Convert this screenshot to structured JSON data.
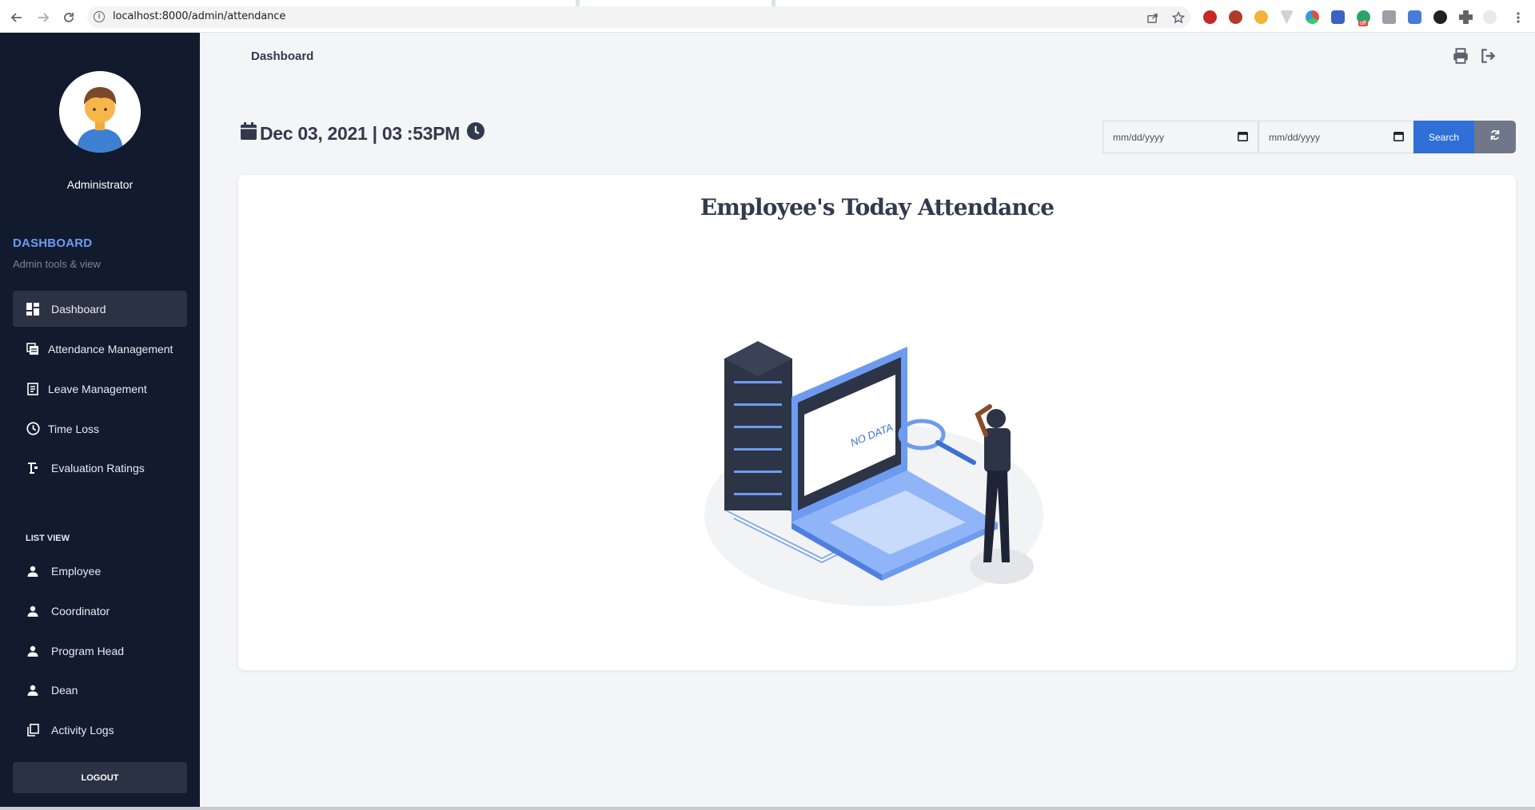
{
  "browser": {
    "url": "localhost:8000/admin/attendance",
    "info_icon": "info-icon",
    "ext_badge": "off"
  },
  "sidebar": {
    "user_name": "Administrator",
    "section_title": "DASHBOARD",
    "section_subtitle": "Admin tools & view",
    "items": [
      {
        "label": "Dashboard",
        "icon": "dashboard-icon"
      },
      {
        "label": "Attendance Management",
        "icon": "attendance-icon"
      },
      {
        "label": "Leave Management",
        "icon": "leave-icon"
      },
      {
        "label": "Time Loss",
        "icon": "clock-icon"
      },
      {
        "label": "Evaluation Ratings",
        "icon": "rating-icon"
      }
    ],
    "list_view_title": "LIST VIEW",
    "list_items": [
      {
        "label": "Employee",
        "icon": "person-icon"
      },
      {
        "label": "Coordinator",
        "icon": "person-icon"
      },
      {
        "label": "Program Head",
        "icon": "person-icon"
      },
      {
        "label": "Dean",
        "icon": "person-icon"
      },
      {
        "label": "Activity Logs",
        "icon": "copy-icon"
      }
    ],
    "logout_label": "LOGOUT"
  },
  "main": {
    "page_title": "Dashboard",
    "datetime": "Dec 03, 2021 | 03 :53PM",
    "date_from_placeholder": "mm/dd/yyyy",
    "date_to_placeholder": "mm/dd/yyyy",
    "search_label": "Search",
    "card_title": "Employee's Today Attendance",
    "illustration_text": "NO DATA"
  },
  "colors": {
    "sidebar_bg": "#121a2e",
    "accent_blue": "#2f6fd6",
    "section_title": "#6c9cf2",
    "main_bg": "#f4f5f7"
  }
}
